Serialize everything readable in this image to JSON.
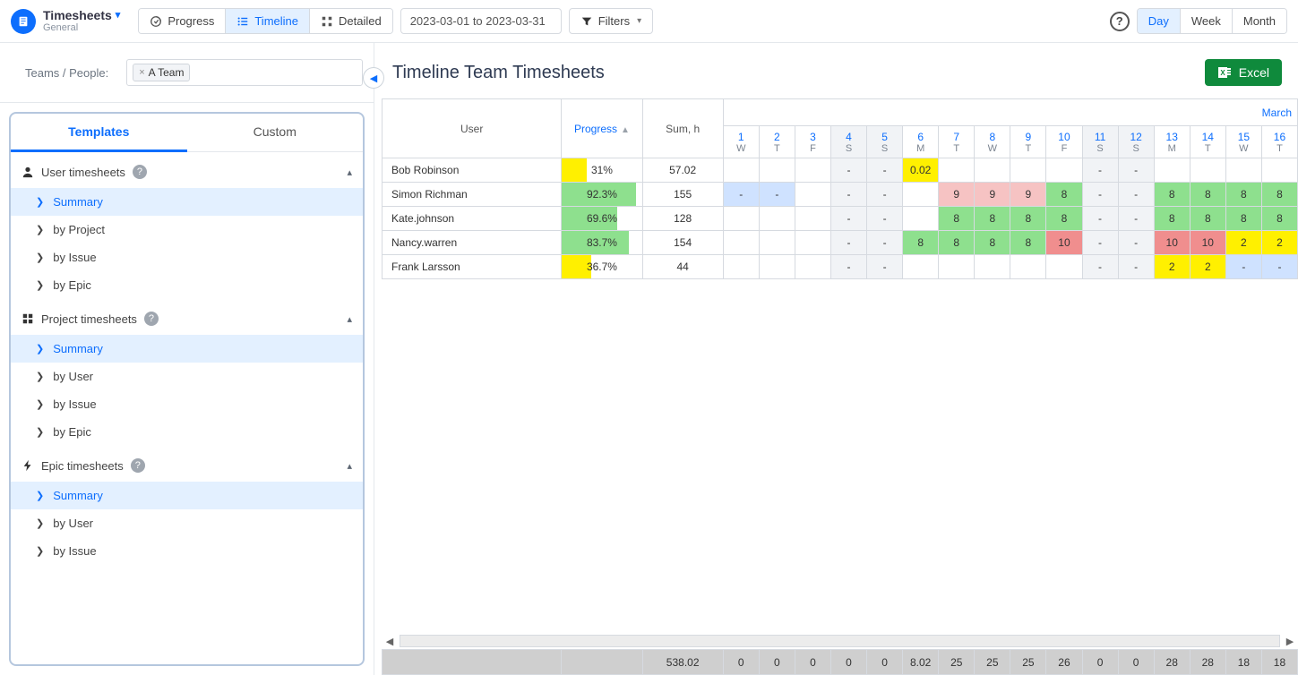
{
  "header": {
    "app_title": "Timesheets",
    "app_subtitle": "General",
    "views": {
      "progress": "Progress",
      "timeline": "Timeline",
      "detailed": "Detailed"
    },
    "date_range": "2023-03-01 to 2023-03-31",
    "filters_label": "Filters",
    "granularity": {
      "day": "Day",
      "week": "Week",
      "month": "Month"
    }
  },
  "sidebar": {
    "filter_label": "Teams / People:",
    "chip": "A Team",
    "tabs": {
      "templates": "Templates",
      "custom": "Custom"
    },
    "groups": [
      {
        "title": "User timesheets",
        "icon": "user",
        "items": [
          "Summary",
          "by Project",
          "by Issue",
          "by Epic"
        ],
        "selected": 0
      },
      {
        "title": "Project timesheets",
        "icon": "grid",
        "items": [
          "Summary",
          "by User",
          "by Issue",
          "by Epic"
        ],
        "selected": 0
      },
      {
        "title": "Epic timesheets",
        "icon": "bolt",
        "items": [
          "Summary",
          "by User",
          "by Issue"
        ],
        "selected": 0
      }
    ]
  },
  "main": {
    "title": "Timeline Team Timesheets",
    "excel_label": "Excel",
    "columns": {
      "user": "User",
      "progress": "Progress",
      "sum": "Sum, h",
      "month": "March"
    },
    "days": [
      {
        "d": "1",
        "w": "W"
      },
      {
        "d": "2",
        "w": "T"
      },
      {
        "d": "3",
        "w": "F"
      },
      {
        "d": "4",
        "w": "S"
      },
      {
        "d": "5",
        "w": "S"
      },
      {
        "d": "6",
        "w": "M"
      },
      {
        "d": "7",
        "w": "T"
      },
      {
        "d": "8",
        "w": "W"
      },
      {
        "d": "9",
        "w": "T"
      },
      {
        "d": "10",
        "w": "F"
      },
      {
        "d": "11",
        "w": "S"
      },
      {
        "d": "12",
        "w": "S"
      },
      {
        "d": "13",
        "w": "M"
      },
      {
        "d": "14",
        "w": "T"
      },
      {
        "d": "15",
        "w": "W"
      },
      {
        "d": "16",
        "w": "T"
      }
    ],
    "rows": [
      {
        "user": "Bob Robinson",
        "progress_pct": 31,
        "progress_color": "#fff000",
        "sum": "57.02",
        "cells": [
          "",
          "",
          "",
          "-",
          "-",
          {
            "v": "0.02",
            "c": "#fff000"
          },
          "",
          "",
          "",
          "",
          "-",
          "-",
          "",
          "",
          "",
          ""
        ]
      },
      {
        "user": "Simon Richman",
        "progress_pct": 92.3,
        "progress_color": "#8ee08e",
        "sum": "155",
        "cells": [
          {
            "v": "-",
            "c": "#cfe2ff"
          },
          {
            "v": "-",
            "c": "#cfe2ff"
          },
          "",
          "-",
          "-",
          "",
          {
            "v": "9",
            "c": "#f6c3c3"
          },
          {
            "v": "9",
            "c": "#f6c3c3"
          },
          {
            "v": "9",
            "c": "#f6c3c3"
          },
          {
            "v": "8",
            "c": "#8ee08e"
          },
          "-",
          "-",
          {
            "v": "8",
            "c": "#8ee08e"
          },
          {
            "v": "8",
            "c": "#8ee08e"
          },
          {
            "v": "8",
            "c": "#8ee08e"
          },
          {
            "v": "8",
            "c": "#8ee08e"
          }
        ]
      },
      {
        "user": "Kate.johnson",
        "progress_pct": 69.6,
        "progress_color": "#8ee08e",
        "sum": "128",
        "cells": [
          "",
          "",
          "",
          "-",
          "-",
          "",
          {
            "v": "8",
            "c": "#8ee08e"
          },
          {
            "v": "8",
            "c": "#8ee08e"
          },
          {
            "v": "8",
            "c": "#8ee08e"
          },
          {
            "v": "8",
            "c": "#8ee08e"
          },
          "-",
          "-",
          {
            "v": "8",
            "c": "#8ee08e"
          },
          {
            "v": "8",
            "c": "#8ee08e"
          },
          {
            "v": "8",
            "c": "#8ee08e"
          },
          {
            "v": "8",
            "c": "#8ee08e"
          }
        ]
      },
      {
        "user": "Nancy.warren",
        "progress_pct": 83.7,
        "progress_color": "#8ee08e",
        "sum": "154",
        "cells": [
          "",
          "",
          "",
          "-",
          "-",
          {
            "v": "8",
            "c": "#8ee08e"
          },
          {
            "v": "8",
            "c": "#8ee08e"
          },
          {
            "v": "8",
            "c": "#8ee08e"
          },
          {
            "v": "8",
            "c": "#8ee08e"
          },
          {
            "v": "10",
            "c": "#f08e8e"
          },
          "-",
          "-",
          {
            "v": "10",
            "c": "#f08e8e"
          },
          {
            "v": "10",
            "c": "#f08e8e"
          },
          {
            "v": "2",
            "c": "#fff000"
          },
          {
            "v": "2",
            "c": "#fff000"
          }
        ]
      },
      {
        "user": "Frank Larsson",
        "progress_pct": 36.7,
        "progress_color": "#fff000",
        "sum": "44",
        "cells": [
          "",
          "",
          "",
          "-",
          "-",
          "",
          "",
          "",
          "",
          "",
          "-",
          "-",
          {
            "v": "2",
            "c": "#fff000"
          },
          {
            "v": "2",
            "c": "#fff000"
          },
          {
            "v": "-",
            "c": "#cfe2ff"
          },
          {
            "v": "-",
            "c": "#cfe2ff"
          }
        ]
      }
    ],
    "totals": [
      "538.02",
      "0",
      "0",
      "0",
      "0",
      "0",
      "8.02",
      "25",
      "25",
      "25",
      "26",
      "0",
      "0",
      "28",
      "28",
      "18",
      "18"
    ]
  }
}
